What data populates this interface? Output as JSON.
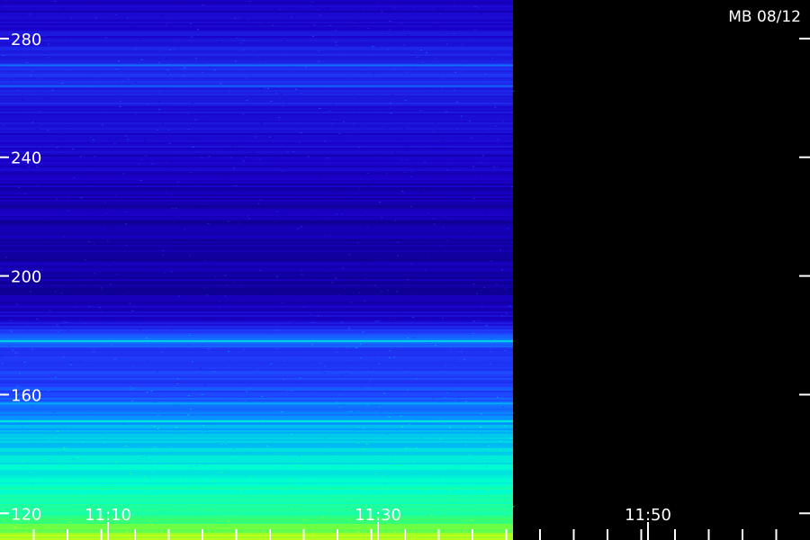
{
  "chart_data": {
    "type": "heatmap",
    "title": "MB 08/12",
    "ylabel": "",
    "xlabel": "",
    "y_ticks": [
      280,
      240,
      200,
      160,
      120
    ],
    "ylim": [
      111,
      293
    ],
    "x_ticks": [
      {
        "label": "11:10",
        "minutes": 670
      },
      {
        "label": "11:30",
        "minutes": 690
      },
      {
        "label": "11:50",
        "minutes": 710
      }
    ],
    "xlim_minutes": [
      662,
      722
    ],
    "data_end_minutes": 700,
    "minor_tick_interval_minutes": 2.5,
    "colormap": [
      "#000055",
      "#1a00c8",
      "#2040ff",
      "#00a0ff",
      "#00ffd0",
      "#40ff60",
      "#e0ff00"
    ],
    "intensity_profile": [
      {
        "freq": 293,
        "level": 0.15
      },
      {
        "freq": 285,
        "level": 0.18
      },
      {
        "freq": 270,
        "level": 0.28
      },
      {
        "freq": 250,
        "level": 0.2
      },
      {
        "freq": 230,
        "level": 0.14
      },
      {
        "freq": 210,
        "level": 0.12
      },
      {
        "freq": 195,
        "level": 0.12
      },
      {
        "freq": 185,
        "level": 0.18
      },
      {
        "freq": 178,
        "level": 0.45
      },
      {
        "freq": 175,
        "level": 0.3
      },
      {
        "freq": 165,
        "level": 0.32
      },
      {
        "freq": 155,
        "level": 0.4
      },
      {
        "freq": 150,
        "level": 0.52
      },
      {
        "freq": 140,
        "level": 0.6
      },
      {
        "freq": 130,
        "level": 0.68
      },
      {
        "freq": 120,
        "level": 0.75
      },
      {
        "freq": 116,
        "level": 0.85
      },
      {
        "freq": 111,
        "level": 0.97
      }
    ],
    "bright_bands_freq": [
      178,
      151,
      157,
      264,
      271
    ],
    "grid": false
  }
}
